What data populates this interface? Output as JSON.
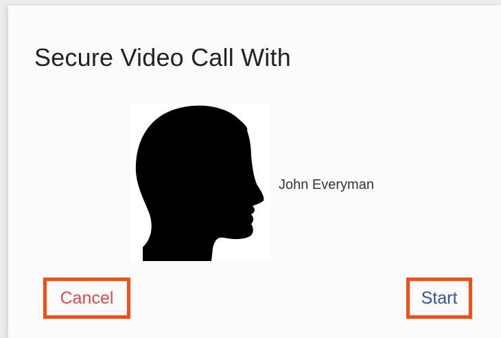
{
  "dialog": {
    "title": "Secure Video Call With",
    "contact": {
      "name": "John Everyman",
      "avatar_icon": "person-silhouette-icon"
    },
    "actions": {
      "cancel_label": "Cancel",
      "start_label": "Start"
    }
  },
  "colors": {
    "highlight_border": "#ff4a10",
    "cancel_text": "#e34a4a",
    "start_text": "#2b55a8"
  }
}
